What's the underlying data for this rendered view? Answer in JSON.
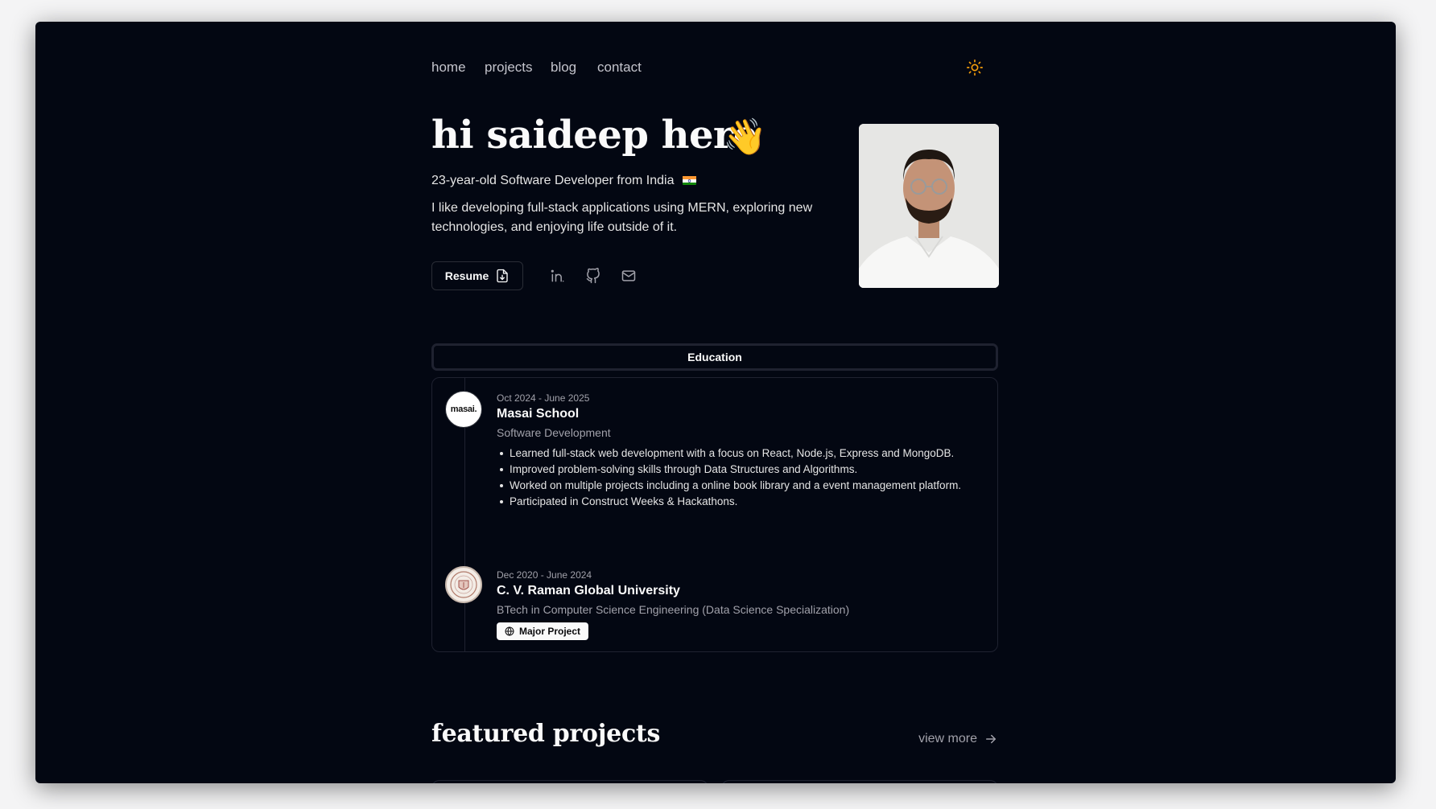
{
  "nav": {
    "links": [
      "home",
      "projects",
      "blog",
      "contact"
    ],
    "theme_icon": "sun-icon"
  },
  "hero": {
    "title": "hi saideep here",
    "wave_emoji": "👋",
    "subtitle": "23-year-old Software Developer from India",
    "bio": "I like developing full-stack applications using MERN, exploring new technologies, and enjoying life outside of it.",
    "resume_label": "Resume",
    "social_icons": [
      "linkedin-icon",
      "github-icon",
      "mail-icon"
    ]
  },
  "education": {
    "tab_label": "Education",
    "entries": [
      {
        "date": "Oct 2024 - June 2025",
        "name": "Masai School",
        "degree": "Software Development",
        "logo_text": "masai.",
        "bullets": [
          "Learned full-stack web development with a focus on React, Node.js, Express and MongoDB.",
          "Improved problem-solving skills through Data Structures and Algorithms.",
          "Worked on multiple projects including a online book library and a event management platform.",
          "Participated in Construct Weeks & Hackathons."
        ]
      },
      {
        "date": "Dec 2020 - June 2024",
        "name": "C. V. Raman Global University",
        "degree": "BTech in Computer Science Engineering (Data Science Specialization)",
        "badge_label": "Major Project"
      }
    ]
  },
  "featured": {
    "title": "featured projects",
    "view_more": "view more"
  },
  "colors": {
    "background": "#030712",
    "text": "#fafafa",
    "muted": "#a1a1aa",
    "border": "#1f2230",
    "accent_sun": "#f59e0b"
  }
}
